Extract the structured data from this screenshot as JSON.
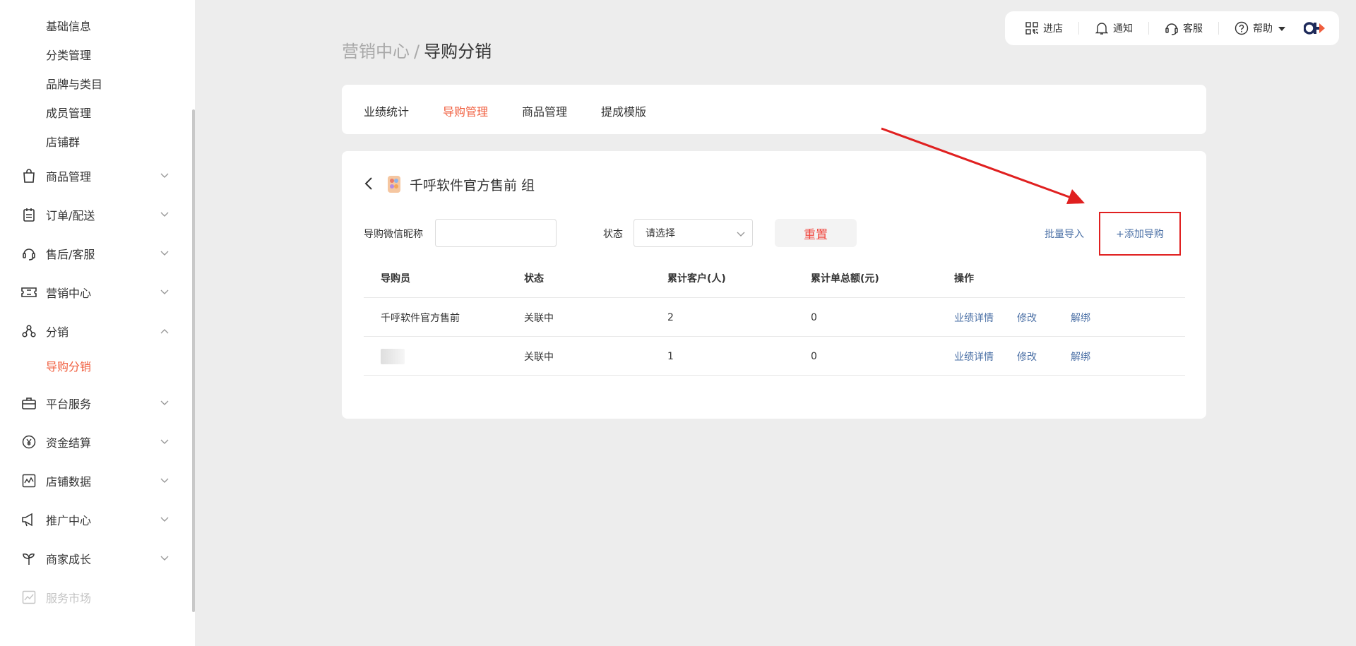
{
  "sidebar": {
    "sub_items_top": [
      {
        "label": "基础信息"
      },
      {
        "label": "分类管理"
      },
      {
        "label": "品牌与类目"
      },
      {
        "label": "成员管理"
      },
      {
        "label": "店铺群"
      }
    ],
    "nav": [
      {
        "label": "商品管理",
        "icon": "shopping-bag-icon",
        "expanded": false
      },
      {
        "label": "订单/配送",
        "icon": "clipboard-icon",
        "expanded": false
      },
      {
        "label": "售后/客服",
        "icon": "headset-icon",
        "expanded": false
      },
      {
        "label": "营销中心",
        "icon": "ticket-icon",
        "expanded": false
      },
      {
        "label": "分销",
        "icon": "distribution-icon",
        "expanded": true
      },
      {
        "label": "平台服务",
        "icon": "briefcase-icon",
        "expanded": false
      },
      {
        "label": "资金结算",
        "icon": "yuan-coin-icon",
        "expanded": false
      },
      {
        "label": "店铺数据",
        "icon": "chart-icon",
        "expanded": false
      },
      {
        "label": "推广中心",
        "icon": "megaphone-icon",
        "expanded": false
      },
      {
        "label": "商家成长",
        "icon": "sprout-icon",
        "expanded": false
      },
      {
        "label": "服务市场",
        "icon": "market-icon",
        "expanded": false,
        "disabled": true
      }
    ],
    "active_sub": "导购分销"
  },
  "topbar": {
    "items": [
      {
        "label": "进店",
        "icon": "qr-code-icon"
      },
      {
        "label": "通知",
        "icon": "bell-icon"
      },
      {
        "label": "客服",
        "icon": "headset-icon"
      },
      {
        "label": "帮助",
        "icon": "help-icon"
      }
    ],
    "logo": "brand-logo"
  },
  "breadcrumb": {
    "parent": "营销中心",
    "separator": "/",
    "current": "导购分销"
  },
  "tabs": [
    {
      "label": "业绩统计",
      "active": false
    },
    {
      "label": "导购管理",
      "active": true
    },
    {
      "label": "商品管理",
      "active": false
    },
    {
      "label": "提成模版",
      "active": false
    }
  ],
  "group": {
    "title": "千呼软件官方售前 组"
  },
  "filters": {
    "nickname_label": "导购微信昵称",
    "nickname_value": "",
    "status_label": "状态",
    "status_placeholder": "请选择",
    "reset_label": "重置",
    "batch_import_label": "批量导入",
    "add_label": "+添加导购"
  },
  "table": {
    "headers": [
      "导购员",
      "状态",
      "累计客户(人)",
      "累计单总额(元)",
      "操作"
    ],
    "rows": [
      {
        "name": "千呼软件官方售前",
        "status": "关联中",
        "customers": "2",
        "total": "0",
        "actions": [
          "业绩详情",
          "修改",
          "解绑"
        ]
      },
      {
        "name": "",
        "status": "关联中",
        "customers": "1",
        "total": "0",
        "actions": [
          "业绩详情",
          "修改",
          "解绑"
        ]
      }
    ]
  },
  "colors": {
    "accent": "#f05d3d",
    "link": "#4a6fa5",
    "highlight_box": "#e02020"
  }
}
